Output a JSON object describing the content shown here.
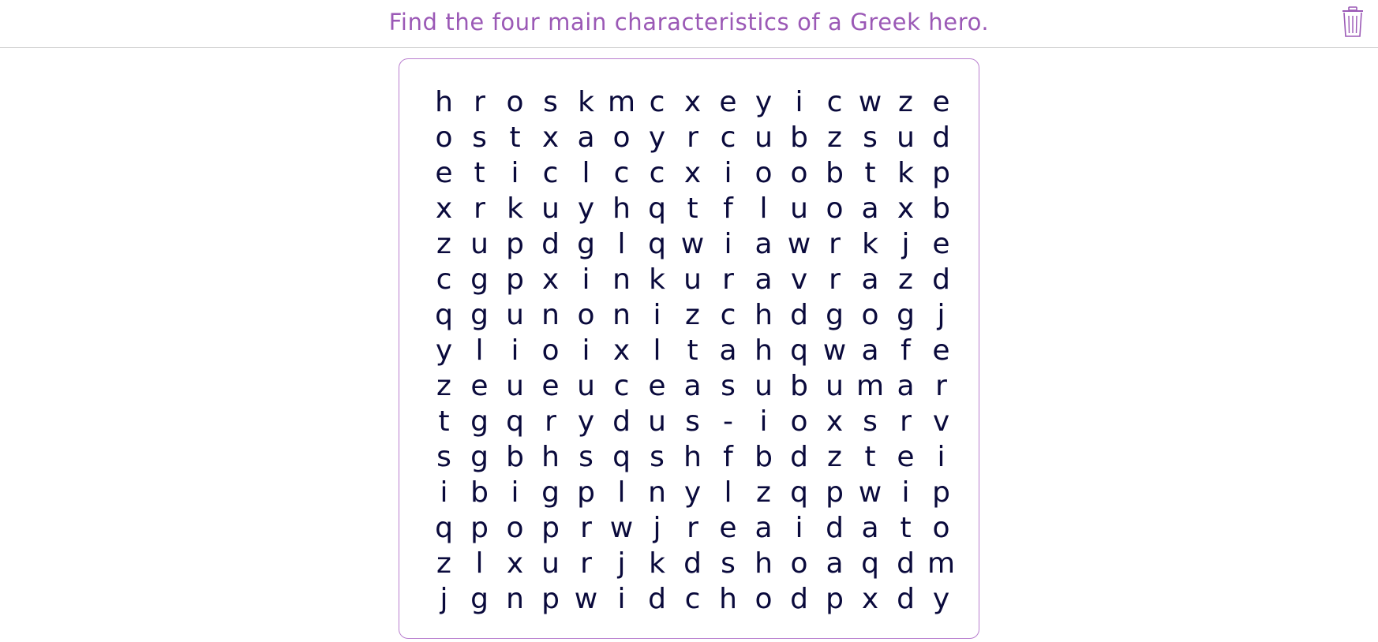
{
  "header": {
    "instruction": "Find the four main characteristics of a Greek hero.",
    "clear_icon": "trash-icon"
  },
  "colors": {
    "title": "#9b59b6",
    "panel_border": "#b97fcf",
    "letter": "#0a0a3c",
    "divider": "#c8c8c8"
  },
  "grid": {
    "rows": [
      [
        "h",
        "r",
        "o",
        "s",
        "k",
        "m",
        "c",
        "x",
        "e",
        "y",
        "i",
        "c",
        "w",
        "z",
        "e"
      ],
      [
        "o",
        "s",
        "t",
        "x",
        "a",
        "o",
        "y",
        "r",
        "c",
        "u",
        "b",
        "z",
        "s",
        "u",
        "d"
      ],
      [
        "e",
        "t",
        "i",
        "c",
        "l",
        "c",
        "c",
        "x",
        "i",
        "o",
        "o",
        "b",
        "t",
        "k",
        "p"
      ],
      [
        "x",
        "r",
        "k",
        "u",
        "y",
        "h",
        "q",
        "t",
        "f",
        "l",
        "u",
        "o",
        "a",
        "x",
        "b"
      ],
      [
        "z",
        "u",
        "p",
        "d",
        "g",
        "l",
        "q",
        "w",
        "i",
        "a",
        "w",
        "r",
        "k",
        "j",
        "e"
      ],
      [
        "c",
        "g",
        "p",
        "x",
        "i",
        "n",
        "k",
        "u",
        "r",
        "a",
        "v",
        "r",
        "a",
        "z",
        "d"
      ],
      [
        "q",
        "g",
        "u",
        "n",
        "o",
        "n",
        "i",
        "z",
        "c",
        "h",
        "d",
        "g",
        "o",
        "g",
        "j"
      ],
      [
        "y",
        "l",
        "i",
        "o",
        "i",
        "x",
        "l",
        "t",
        "a",
        "h",
        "q",
        "w",
        "a",
        "f",
        "e"
      ],
      [
        "z",
        "e",
        "u",
        "e",
        "u",
        "c",
        "e",
        "a",
        "s",
        "u",
        "b",
        "u",
        "m",
        "a",
        "r"
      ],
      [
        "t",
        "g",
        "q",
        "r",
        "y",
        "d",
        "u",
        "s",
        "-",
        "i",
        "o",
        "x",
        "s",
        "r",
        "v"
      ],
      [
        "s",
        "g",
        "b",
        "h",
        "s",
        "q",
        "s",
        "h",
        "f",
        "b",
        "d",
        "z",
        "t",
        "e",
        "i"
      ],
      [
        "i",
        "b",
        "i",
        "g",
        "p",
        "l",
        "n",
        "y",
        "l",
        "z",
        "q",
        "p",
        "w",
        "i",
        "p"
      ],
      [
        "q",
        "p",
        "o",
        "p",
        "r",
        "w",
        "j",
        "r",
        "e",
        "a",
        "i",
        "d",
        "a",
        "t",
        "o"
      ],
      [
        "z",
        "l",
        "x",
        "u",
        "r",
        "j",
        "k",
        "d",
        "s",
        "h",
        "o",
        "a",
        "q",
        "d",
        "m"
      ],
      [
        "j",
        "g",
        "n",
        "p",
        "w",
        "i",
        "d",
        "c",
        "h",
        "o",
        "d",
        "p",
        "x",
        "d",
        "y"
      ]
    ]
  }
}
